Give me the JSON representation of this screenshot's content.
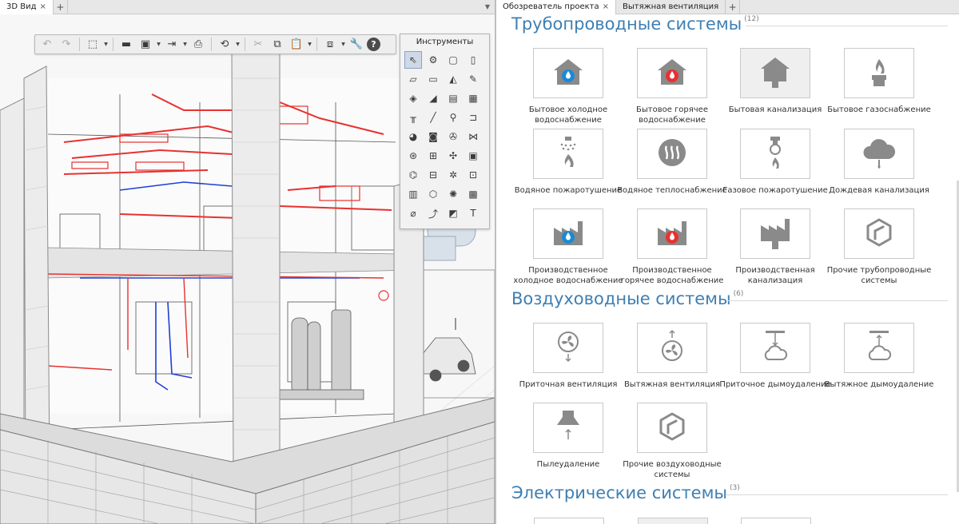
{
  "left_pane": {
    "tabs": [
      {
        "label": "3D Вид"
      }
    ],
    "tools_panel": {
      "title": "Инструменты",
      "tools": [
        {
          "icon": "pointer-icon",
          "glyph": "⇖"
        },
        {
          "icon": "equipment-icon",
          "glyph": "⚙"
        },
        {
          "icon": "room-icon",
          "glyph": "▢"
        },
        {
          "icon": "door-icon",
          "glyph": "▯"
        },
        {
          "icon": "slab-icon",
          "glyph": "▱"
        },
        {
          "icon": "beam-icon",
          "glyph": "▭"
        },
        {
          "icon": "roof-icon",
          "glyph": "◭"
        },
        {
          "icon": "pencil-icon",
          "glyph": "✎"
        },
        {
          "icon": "duct-icon",
          "glyph": "◈"
        },
        {
          "icon": "ramp-icon",
          "glyph": "◢"
        },
        {
          "icon": "panel-icon",
          "glyph": "▤"
        },
        {
          "icon": "window-icon",
          "glyph": "▦"
        },
        {
          "icon": "table-icon",
          "glyph": "╥"
        },
        {
          "icon": "line-icon",
          "glyph": "╱"
        },
        {
          "icon": "faucet-icon",
          "glyph": "⚲"
        },
        {
          "icon": "pipe-fitting-icon",
          "glyph": "⊐"
        },
        {
          "icon": "toilet-icon",
          "glyph": "◕"
        },
        {
          "icon": "washer-icon",
          "glyph": "◙"
        },
        {
          "icon": "fan-coil-icon",
          "glyph": "✇"
        },
        {
          "icon": "valve-icon",
          "glyph": "⋈"
        },
        {
          "icon": "pump-icon",
          "glyph": "⊛"
        },
        {
          "icon": "tank-icon",
          "glyph": "⊞"
        },
        {
          "icon": "fan-icon",
          "glyph": "✣"
        },
        {
          "icon": "vent-icon",
          "glyph": "▣"
        },
        {
          "icon": "boiler-icon",
          "glyph": "⌬"
        },
        {
          "icon": "radiator-icon",
          "glyph": "⊟"
        },
        {
          "icon": "sprinkler-icon",
          "glyph": "✲"
        },
        {
          "icon": "meter-icon",
          "glyph": "⊡"
        },
        {
          "icon": "cabinet-icon",
          "glyph": "▥"
        },
        {
          "icon": "shield-icon",
          "glyph": "⬡"
        },
        {
          "icon": "lamp-icon",
          "glyph": "✺"
        },
        {
          "icon": "grid-icon",
          "glyph": "▩"
        },
        {
          "icon": "dimension-icon",
          "glyph": "⌀"
        },
        {
          "icon": "cable-icon",
          "glyph": "⤴"
        },
        {
          "icon": "fill-icon",
          "glyph": "◩"
        },
        {
          "icon": "text-icon",
          "glyph": "T"
        }
      ]
    }
  },
  "right_pane": {
    "tabs": [
      {
        "label": "Обозреватель проекта"
      },
      {
        "label": "Вытяжная вентиляция"
      }
    ],
    "sections": [
      {
        "title": "Трубопроводные системы",
        "count": "(12)",
        "items": [
          {
            "label": "Бытовое холодное водоснабжение",
            "icon": "cold-water-house-icon",
            "style": "white"
          },
          {
            "label": "Бытовое горячее водоснабжение",
            "icon": "hot-water-house-icon",
            "style": "white"
          },
          {
            "label": "Бытовая канализация",
            "icon": "sewage-house-icon",
            "style": "gray"
          },
          {
            "label": "Бытовое газоснабжение",
            "icon": "gas-flame-icon",
            "style": "white"
          },
          {
            "label": "Водяное пожаротушение",
            "icon": "water-sprinkler-icon",
            "style": "white"
          },
          {
            "label": "Водяное теплоснабжение",
            "icon": "heating-waves-icon",
            "style": "white"
          },
          {
            "label": "Газовое пожаротушение",
            "icon": "gas-sprinkler-icon",
            "style": "white"
          },
          {
            "label": "Дождевая канализация",
            "icon": "rain-cloud-icon",
            "style": "white"
          },
          {
            "label": "Производственное холодное водоснабжение",
            "icon": "cold-water-factory-icon",
            "style": "white"
          },
          {
            "label": "Производственное горячее водоснабжение",
            "icon": "hot-water-factory-icon",
            "style": "white"
          },
          {
            "label": "Производственная канализация",
            "icon": "sewage-factory-icon",
            "style": "white"
          },
          {
            "label": "Прочие трубопроводные системы",
            "icon": "other-system-icon",
            "style": "white"
          }
        ]
      },
      {
        "title": "Воздуховодные системы",
        "count": "(6)",
        "items": [
          {
            "label": "Приточная вентиляция",
            "icon": "supply-fan-icon",
            "style": "white"
          },
          {
            "label": "Вытяжная вентиляция",
            "icon": "exhaust-fan-icon",
            "style": "white"
          },
          {
            "label": "Приточное дымоудаление",
            "icon": "supply-smoke-icon",
            "style": "white"
          },
          {
            "label": "Вытяжное дымоудаление",
            "icon": "exhaust-smoke-icon",
            "style": "white"
          },
          {
            "label": "Пылеудаление",
            "icon": "dust-hood-icon",
            "style": "white"
          },
          {
            "label": "Прочие воздуховодные системы",
            "icon": "other-system-icon",
            "style": "white"
          }
        ]
      },
      {
        "title": "Электрические системы",
        "count": "(3)",
        "items": []
      }
    ]
  },
  "colors": {
    "accent": "#3f7fb2",
    "cold_water": "#1a8ad4",
    "hot_water": "#e8312f",
    "icon_gray": "#8a8a8a"
  }
}
